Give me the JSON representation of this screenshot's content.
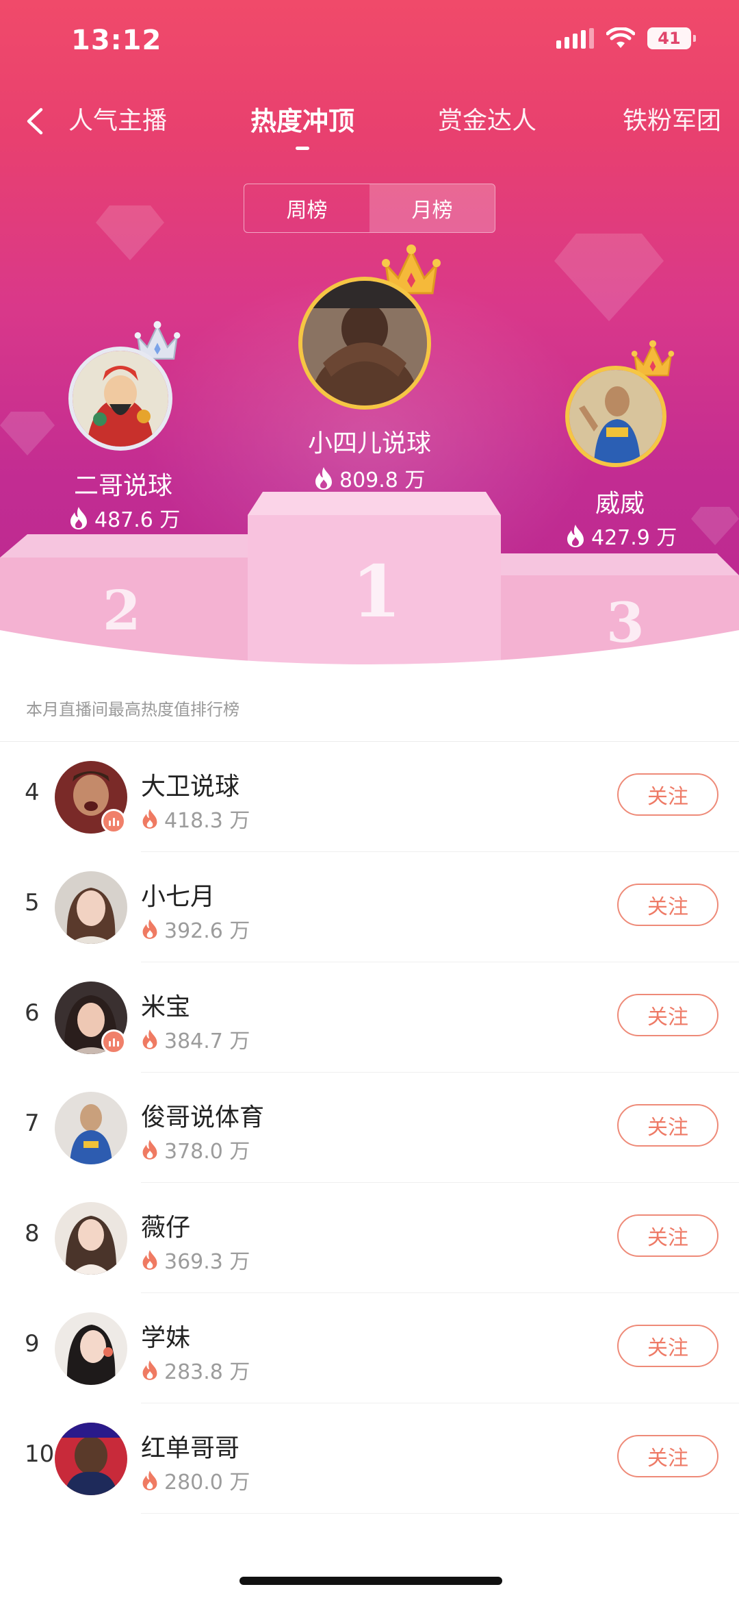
{
  "status_bar": {
    "time": "13:12",
    "battery": "41",
    "signal_icon": "signal-icon",
    "wifi_icon": "wifi-icon"
  },
  "nav": {
    "back_icon": "chevron-left-icon",
    "tabs": [
      {
        "label": "人气主播",
        "active": false
      },
      {
        "label": "热度冲顶",
        "active": true
      },
      {
        "label": "赏金达人",
        "active": false
      },
      {
        "label": "铁粉军团",
        "active": false
      }
    ]
  },
  "segment": {
    "options": [
      {
        "label": "周榜",
        "active": false
      },
      {
        "label": "月榜",
        "active": true
      }
    ]
  },
  "podium": {
    "first": {
      "rank": "1",
      "name": "小四儿说球",
      "heat": "809.8 万"
    },
    "second": {
      "rank": "2",
      "name": "二哥说球",
      "heat": "487.6 万"
    },
    "third": {
      "rank": "3",
      "name": "威威",
      "heat": "427.9 万"
    }
  },
  "caption": "本月直播间最高热度值排行榜",
  "list": [
    {
      "rank": "4",
      "name": "大卫说球",
      "heat": "418.3 万",
      "live": true,
      "follow_label": "关注"
    },
    {
      "rank": "5",
      "name": "小七月",
      "heat": "392.6 万",
      "live": false,
      "follow_label": "关注"
    },
    {
      "rank": "6",
      "name": "米宝",
      "heat": "384.7 万",
      "live": true,
      "follow_label": "关注"
    },
    {
      "rank": "7",
      "name": "俊哥说体育",
      "heat": "378.0 万",
      "live": false,
      "follow_label": "关注"
    },
    {
      "rank": "8",
      "name": "薇仔",
      "heat": "369.3 万",
      "live": false,
      "follow_label": "关注"
    },
    {
      "rank": "9",
      "name": "学妹",
      "heat": "283.8 万",
      "live": false,
      "follow_label": "关注"
    },
    {
      "rank": "10",
      "name": "红单哥哥",
      "heat": "280.0 万",
      "live": false,
      "follow_label": "关注"
    }
  ],
  "colors": {
    "hero_top": "#f04a6a",
    "hero_bottom": "#b9288f",
    "accent": "#ee7a66",
    "gold": "#f5c644"
  }
}
